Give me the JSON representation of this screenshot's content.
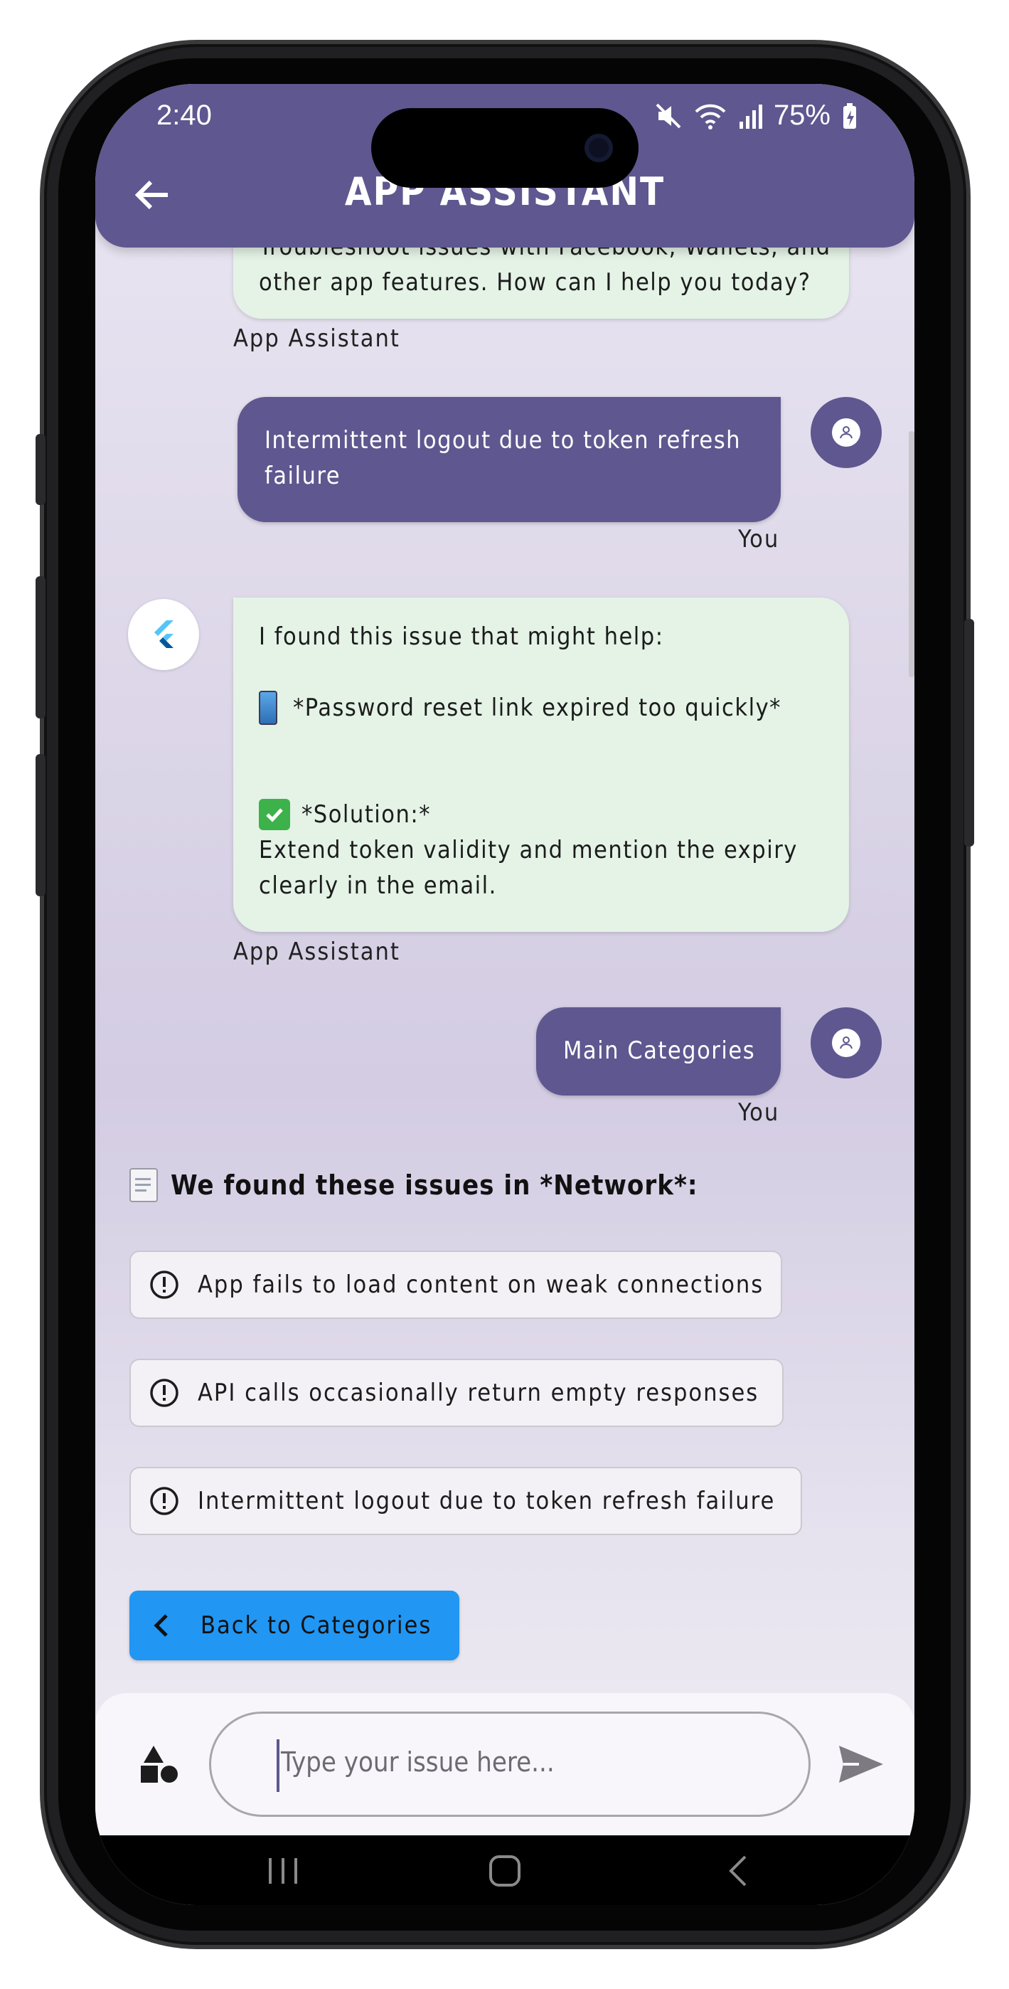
{
  "status_bar": {
    "time": "2:40",
    "battery": "75%"
  },
  "app_bar": {
    "title": "APP ASSISTANT"
  },
  "messages": {
    "first_bot_partial": {
      "line1": "Troubleshoot issues with Facebook, Wallets, and",
      "line2": "other app features. How can I help you today?",
      "sender": "App Assistant"
    },
    "user_1": {
      "line1": "Intermittent logout due to token refresh",
      "line2": "failure",
      "sender": "You"
    },
    "bot_2": {
      "intro": "I found this issue that might help:",
      "issue": "*Password reset link expired too quickly*",
      "solution_label": "*Solution:*",
      "solution_line1": "Extend token validity and mention the expiry",
      "solution_line2": "clearly in the email.",
      "sender": "App Assistant"
    },
    "user_2": {
      "text": "Main Categories",
      "sender": "You"
    }
  },
  "issues": {
    "heading": "We found these issues in *Network*:",
    "items": [
      "App fails to load content on weak connections",
      "API calls occasionally return empty responses",
      "Intermittent logout due to token refresh failure"
    ],
    "back_button": "Back to Categories"
  },
  "input": {
    "placeholder": "Type your issue here..."
  },
  "colors": {
    "primary": "#5f578f",
    "bot_bubble": "#e4f3e6",
    "back_button": "#2196f3"
  }
}
